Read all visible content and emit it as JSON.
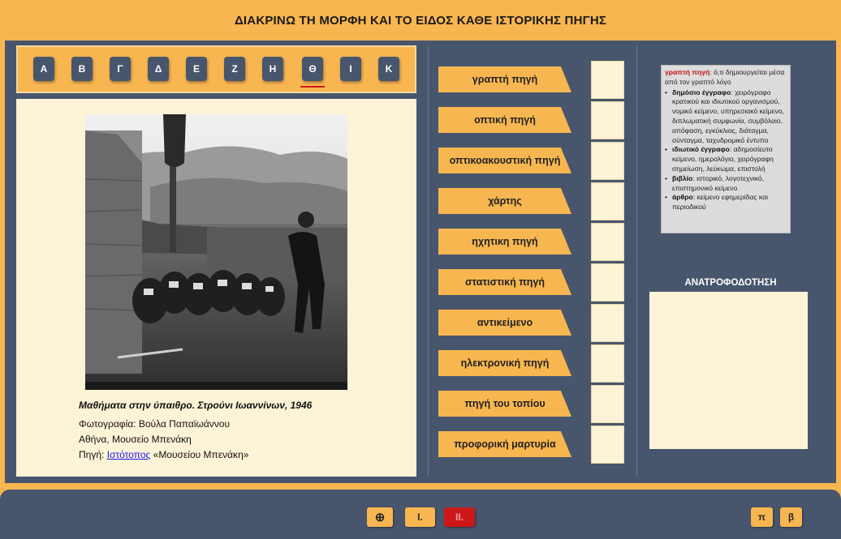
{
  "title": "ΔΙΑΚΡΙΝΩ ΤΗ ΜΟΡΦΗ ΚΑΙ ΤΟ ΕΙΔΟΣ ΚΑΘΕ ΙΣΤΟΡΙΚΗΣ ΠΗΓΗΣ",
  "letters": [
    "Α",
    "Β",
    "Γ",
    "Δ",
    "Ε",
    "Ζ",
    "Η",
    "Θ",
    "Ι",
    "Κ"
  ],
  "active_letter": "Θ",
  "caption": {
    "title": "Μαθήματα στην ύπαιθρο. Στρούνι Ιωαννίνων, 1946",
    "line1": "Φωτογραφία: Βούλα Παπαϊωάννου",
    "line2": "Αθήνα, Μουσείο Μπενάκη",
    "source_prefix": "Πηγή: ",
    "source_link": "Ιστότοπος",
    "source_suffix": " «Μουσείου Μπενάκη»"
  },
  "source_types": [
    "γραπτή πηγή",
    "οπτική πηγή",
    "οπτικοακουστική πηγή",
    "χάρτης",
    "ηχητικη πηγή",
    "στατιστική πηγή",
    "αντικείμενο",
    "ηλεκτρονική πηγή",
    "πηγή του τοπίου",
    "προφορική μαρτυρία"
  ],
  "info": {
    "term": "γραπτή πηγή",
    "definition": ": ό,τι δημιουργείται μέσα από τον γραπτό λόγο",
    "items": [
      {
        "label": "δημόσιο έγγραφο",
        "text": ": χειρόγραφο κρατικού και ιδιωτικού οργανισμού, νομικό κείμενο, υπηρεσιακό κείμενο, διπλωματική συμφωνία, συμβόλαιο, απόφαση, εγκύκλιος, διάταγμα, σύνταγμα, ταχυδρομικό έντυπο"
      },
      {
        "label": "ιδιωτικό έγγραφο",
        "text": ": αδημοσίευτο κείμενο, ημερολόγιο, χειρόγραφη σημείωση, λεύκωμα, επιστολή"
      },
      {
        "label": "βιβλίο",
        "text": ": ιστορικό, λογοτεχνικό, επιστημονικό κείμενο"
      },
      {
        "label": "άρθρο",
        "text": ": κείμενο εφημερίδας και περιοδικού"
      }
    ]
  },
  "feedback_title": "ΑΝΑΤΡΟΦΟΔΟΤΗΣΗ",
  "controls": {
    "zoom_icon": "⊕",
    "btn_i": "I.",
    "btn_ii": "II.",
    "btn_pi": "π",
    "btn_beta": "β"
  }
}
